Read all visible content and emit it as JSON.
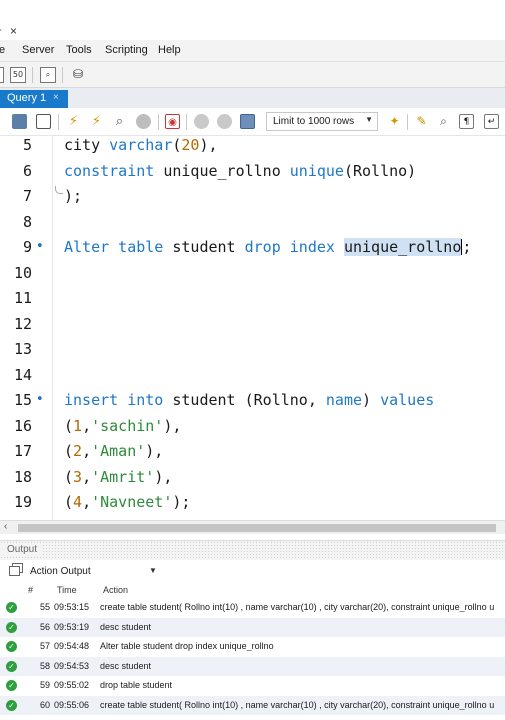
{
  "window": {
    "close_glyph": "×"
  },
  "menu": [
    "e",
    "Server",
    "Tools",
    "Scripting",
    "Help"
  ],
  "tab": {
    "label": "Query 1",
    "close_glyph": "×"
  },
  "toolbar": {
    "limit_label": "Limit to 1000 rows"
  },
  "editor": {
    "lines": [
      {
        "num": "5",
        "marker": "",
        "tokens": [
          {
            "t": "city ",
            "c": ""
          },
          {
            "t": "varchar",
            "c": "kw"
          },
          {
            "t": "(",
            "c": ""
          },
          {
            "t": "20",
            "c": "num"
          },
          {
            "t": "),",
            "c": ""
          }
        ]
      },
      {
        "num": "6",
        "marker": "",
        "tokens": [
          {
            "t": "constraint",
            "c": "kw"
          },
          {
            "t": " unique_rollno ",
            "c": ""
          },
          {
            "t": "unique",
            "c": "kw"
          },
          {
            "t": "(Rollno)",
            "c": ""
          }
        ]
      },
      {
        "num": "7",
        "marker": "",
        "tokens": [
          {
            "t": ");",
            "c": ""
          }
        ]
      },
      {
        "num": "8",
        "marker": "",
        "tokens": []
      },
      {
        "num": "9",
        "marker": "•",
        "tokens": [
          {
            "t": "Alter table",
            "c": "kw"
          },
          {
            "t": " student ",
            "c": ""
          },
          {
            "t": "drop index",
            "c": "kw"
          },
          {
            "t": " ",
            "c": ""
          },
          {
            "t": "unique_rollno",
            "c": "sel"
          },
          {
            "t": "|",
            "c": "caret"
          },
          {
            "t": ";",
            "c": ""
          }
        ]
      },
      {
        "num": "10",
        "marker": "",
        "tokens": []
      },
      {
        "num": "11",
        "marker": "",
        "tokens": []
      },
      {
        "num": "12",
        "marker": "",
        "tokens": []
      },
      {
        "num": "13",
        "marker": "",
        "tokens": []
      },
      {
        "num": "14",
        "marker": "",
        "tokens": []
      },
      {
        "num": "15",
        "marker": "•",
        "tokens": [
          {
            "t": "insert into",
            "c": "kw"
          },
          {
            "t": " student (Rollno, ",
            "c": ""
          },
          {
            "t": "name",
            "c": "kw"
          },
          {
            "t": ") ",
            "c": ""
          },
          {
            "t": "values",
            "c": "kw"
          }
        ]
      },
      {
        "num": "16",
        "marker": "",
        "tokens": [
          {
            "t": "(",
            "c": ""
          },
          {
            "t": "1",
            "c": "num"
          },
          {
            "t": ",",
            "c": ""
          },
          {
            "t": "'sachin'",
            "c": "str"
          },
          {
            "t": "),",
            "c": ""
          }
        ]
      },
      {
        "num": "17",
        "marker": "",
        "tokens": [
          {
            "t": "(",
            "c": ""
          },
          {
            "t": "2",
            "c": "num"
          },
          {
            "t": ",",
            "c": ""
          },
          {
            "t": "'Aman'",
            "c": "str"
          },
          {
            "t": "),",
            "c": ""
          }
        ]
      },
      {
        "num": "18",
        "marker": "",
        "tokens": [
          {
            "t": "(",
            "c": ""
          },
          {
            "t": "3",
            "c": "num"
          },
          {
            "t": ",",
            "c": ""
          },
          {
            "t": "'Amrit'",
            "c": "str"
          },
          {
            "t": "),",
            "c": ""
          }
        ]
      },
      {
        "num": "19",
        "marker": "",
        "tokens": [
          {
            "t": "(",
            "c": ""
          },
          {
            "t": "4",
            "c": "num"
          },
          {
            "t": ",",
            "c": ""
          },
          {
            "t": "'Navneet'",
            "c": "str"
          },
          {
            "t": ");",
            "c": ""
          }
        ]
      }
    ]
  },
  "output": {
    "panel_label": "Output",
    "selector_label": "Action Output",
    "columns": [
      "#",
      "Time",
      "Action"
    ],
    "rows": [
      {
        "n": "55",
        "time": "09:53:15",
        "action": "create table student( Rollno int(10) , name varchar(10) , city varchar(20), constraint unique_rollno u"
      },
      {
        "n": "56",
        "time": "09:53:19",
        "action": "desc student"
      },
      {
        "n": "57",
        "time": "09:54:48",
        "action": "Alter table student drop index unique_rollno"
      },
      {
        "n": "58",
        "time": "09:54:53",
        "action": "desc student"
      },
      {
        "n": "59",
        "time": "09:55:02",
        "action": "drop table student"
      },
      {
        "n": "60",
        "time": "09:55:06",
        "action": "create table student( Rollno int(10) , name varchar(10) , city varchar(20), constraint unique_rollno u"
      }
    ]
  },
  "colors": {
    "keyword": "#1f77c9",
    "number": "#b36a00",
    "string": "#2e8b3a",
    "tab_active": "#1979ca",
    "success": "#2e9e3e",
    "selection": "#cfe1f3"
  }
}
